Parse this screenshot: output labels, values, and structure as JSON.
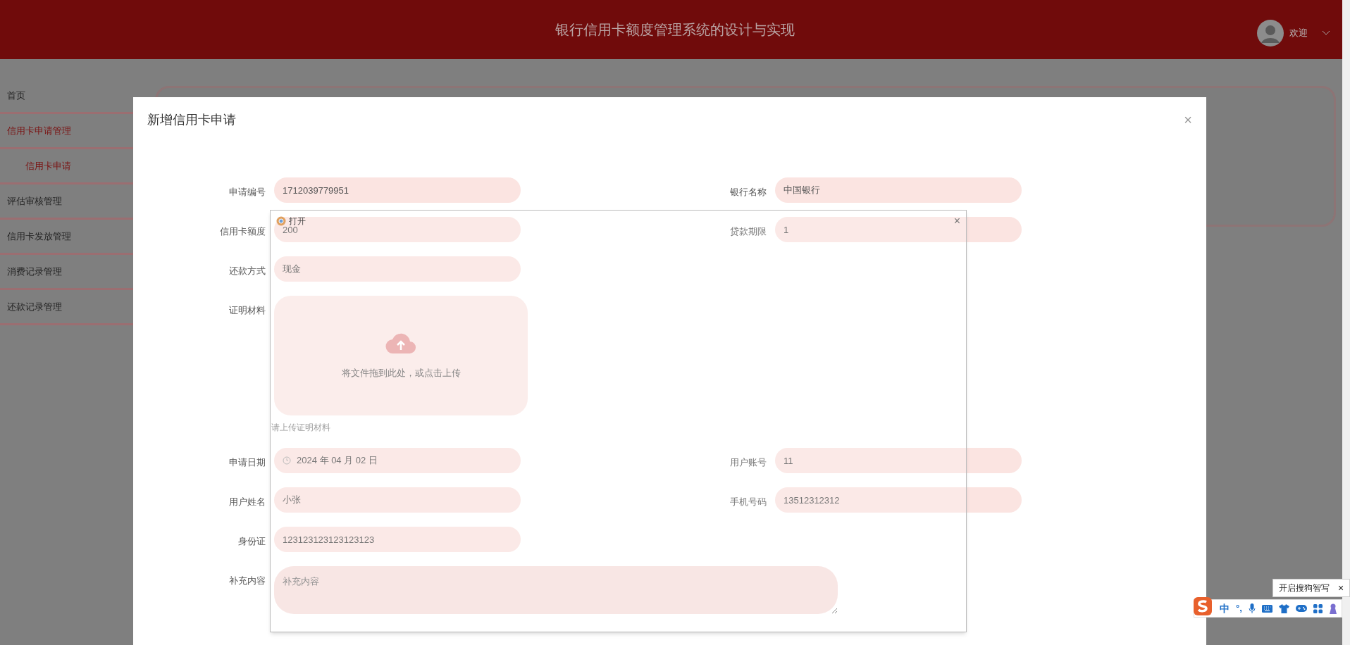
{
  "header": {
    "title": "银行信用卡额度管理系统的设计与实现",
    "user_label": "欢迎"
  },
  "sidebar": [
    {
      "label": "首页",
      "selected": false
    },
    {
      "label": "信用卡申请管理",
      "selected": true,
      "children": [
        {
          "label": "信用卡申请",
          "selected": true
        }
      ]
    },
    {
      "label": "评估审核管理",
      "selected": false
    },
    {
      "label": "信用卡发放管理",
      "selected": false
    },
    {
      "label": "消费记录管理",
      "selected": false
    },
    {
      "label": "还款记录管理",
      "selected": false
    }
  ],
  "dialog": {
    "title": "新增信用卡申请",
    "close": "×",
    "rows": [
      [
        {
          "kind": "text",
          "label": "申请编号",
          "value": "1712039779951"
        },
        {
          "kind": "text",
          "label": "银行名称",
          "value": "中国银行"
        }
      ],
      [
        {
          "kind": "text",
          "label": "信用卡额度",
          "value": "200"
        },
        {
          "kind": "text",
          "label": "贷款期限",
          "value": "1"
        }
      ],
      [
        {
          "kind": "text",
          "label": "还款方式",
          "value": "现金"
        }
      ],
      [
        {
          "kind": "upload",
          "label": "证明材料",
          "value": "将文件拖到此处，或点击上传",
          "hint": "请上传证明材料"
        }
      ],
      [
        {
          "kind": "date",
          "label": "申请日期",
          "value": "2024 年 04 月 02 日"
        },
        {
          "kind": "text",
          "label": "用户账号",
          "value": "11"
        }
      ],
      [
        {
          "kind": "text",
          "label": "用户姓名",
          "value": "小张"
        },
        {
          "kind": "text",
          "label": "手机号码",
          "value": "13512312312"
        }
      ],
      [
        {
          "kind": "text",
          "label": "身份证",
          "value": "123123123123123123"
        }
      ],
      [
        {
          "kind": "textarea",
          "label": "补充内容",
          "placeholder": "补充内容"
        }
      ]
    ]
  },
  "file_window": {
    "title": "打开",
    "close": "×"
  },
  "ime": {
    "tooltip": "开启搜狗智写",
    "tooltip_close": "×",
    "mode": "中",
    "punctuation": "°,"
  }
}
